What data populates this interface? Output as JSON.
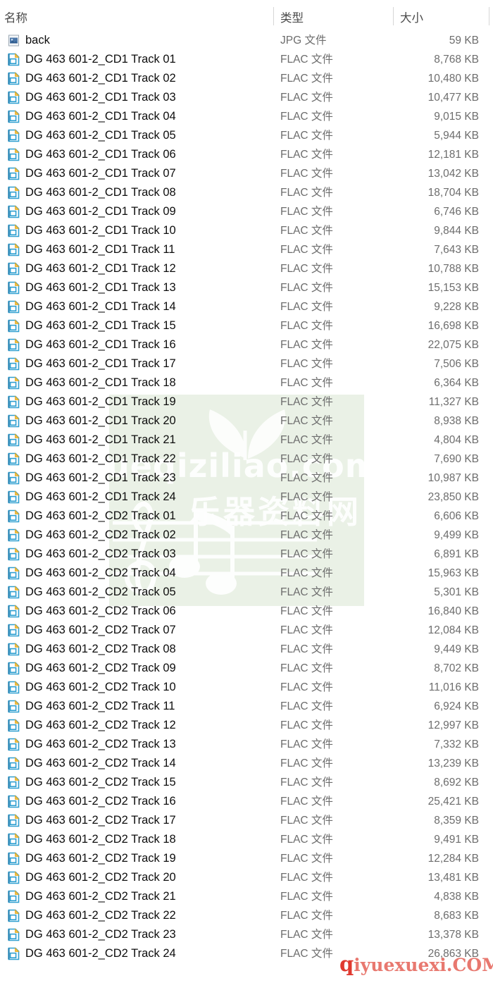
{
  "window": {
    "view": "details-list",
    "columns": [
      {
        "key": "name",
        "label": "名称",
        "align": "left"
      },
      {
        "key": "type",
        "label": "类型",
        "align": "left"
      },
      {
        "key": "size",
        "label": "大小",
        "align": "right"
      }
    ]
  },
  "watermarks": {
    "green_text": "yueqiziliao.com",
    "green_cn": "乐器资料网",
    "green_color": "#e3ecdd",
    "red_text_lead": "q",
    "red_text_rest": "iyuexuexi.COM",
    "red_color": "#e8786f"
  },
  "icons": {
    "image_file": "image-file-icon",
    "flac_file": "flac-file-icon"
  },
  "rows": [
    {
      "icon": "image-file-icon",
      "name": "back",
      "type": "JPG 文件",
      "size": "59 KB"
    },
    {
      "icon": "flac-file-icon",
      "name": "DG 463 601-2_CD1 Track 01",
      "type": "FLAC 文件",
      "size": "8,768 KB"
    },
    {
      "icon": "flac-file-icon",
      "name": "DG 463 601-2_CD1 Track 02",
      "type": "FLAC 文件",
      "size": "10,480 KB"
    },
    {
      "icon": "flac-file-icon",
      "name": "DG 463 601-2_CD1 Track 03",
      "type": "FLAC 文件",
      "size": "10,477 KB"
    },
    {
      "icon": "flac-file-icon",
      "name": "DG 463 601-2_CD1 Track 04",
      "type": "FLAC 文件",
      "size": "9,015 KB"
    },
    {
      "icon": "flac-file-icon",
      "name": "DG 463 601-2_CD1 Track 05",
      "type": "FLAC 文件",
      "size": "5,944 KB"
    },
    {
      "icon": "flac-file-icon",
      "name": "DG 463 601-2_CD1 Track 06",
      "type": "FLAC 文件",
      "size": "12,181 KB"
    },
    {
      "icon": "flac-file-icon",
      "name": "DG 463 601-2_CD1 Track 07",
      "type": "FLAC 文件",
      "size": "13,042 KB"
    },
    {
      "icon": "flac-file-icon",
      "name": "DG 463 601-2_CD1 Track 08",
      "type": "FLAC 文件",
      "size": "18,704 KB"
    },
    {
      "icon": "flac-file-icon",
      "name": "DG 463 601-2_CD1 Track 09",
      "type": "FLAC 文件",
      "size": "6,746 KB"
    },
    {
      "icon": "flac-file-icon",
      "name": "DG 463 601-2_CD1 Track 10",
      "type": "FLAC 文件",
      "size": "9,844 KB"
    },
    {
      "icon": "flac-file-icon",
      "name": "DG 463 601-2_CD1 Track 11",
      "type": "FLAC 文件",
      "size": "7,643 KB"
    },
    {
      "icon": "flac-file-icon",
      "name": "DG 463 601-2_CD1 Track 12",
      "type": "FLAC 文件",
      "size": "10,788 KB"
    },
    {
      "icon": "flac-file-icon",
      "name": "DG 463 601-2_CD1 Track 13",
      "type": "FLAC 文件",
      "size": "15,153 KB"
    },
    {
      "icon": "flac-file-icon",
      "name": "DG 463 601-2_CD1 Track 14",
      "type": "FLAC 文件",
      "size": "9,228 KB"
    },
    {
      "icon": "flac-file-icon",
      "name": "DG 463 601-2_CD1 Track 15",
      "type": "FLAC 文件",
      "size": "16,698 KB"
    },
    {
      "icon": "flac-file-icon",
      "name": "DG 463 601-2_CD1 Track 16",
      "type": "FLAC 文件",
      "size": "22,075 KB"
    },
    {
      "icon": "flac-file-icon",
      "name": "DG 463 601-2_CD1 Track 17",
      "type": "FLAC 文件",
      "size": "7,506 KB"
    },
    {
      "icon": "flac-file-icon",
      "name": "DG 463 601-2_CD1 Track 18",
      "type": "FLAC 文件",
      "size": "6,364 KB"
    },
    {
      "icon": "flac-file-icon",
      "name": "DG 463 601-2_CD1 Track 19",
      "type": "FLAC 文件",
      "size": "11,327 KB"
    },
    {
      "icon": "flac-file-icon",
      "name": "DG 463 601-2_CD1 Track 20",
      "type": "FLAC 文件",
      "size": "8,938 KB"
    },
    {
      "icon": "flac-file-icon",
      "name": "DG 463 601-2_CD1 Track 21",
      "type": "FLAC 文件",
      "size": "4,804 KB"
    },
    {
      "icon": "flac-file-icon",
      "name": "DG 463 601-2_CD1 Track 22",
      "type": "FLAC 文件",
      "size": "7,690 KB"
    },
    {
      "icon": "flac-file-icon",
      "name": "DG 463 601-2_CD1 Track 23",
      "type": "FLAC 文件",
      "size": "10,987 KB"
    },
    {
      "icon": "flac-file-icon",
      "name": "DG 463 601-2_CD1 Track 24",
      "type": "FLAC 文件",
      "size": "23,850 KB"
    },
    {
      "icon": "flac-file-icon",
      "name": "DG 463 601-2_CD2 Track 01",
      "type": "FLAC 文件",
      "size": "6,606 KB"
    },
    {
      "icon": "flac-file-icon",
      "name": "DG 463 601-2_CD2 Track 02",
      "type": "FLAC 文件",
      "size": "9,499 KB"
    },
    {
      "icon": "flac-file-icon",
      "name": "DG 463 601-2_CD2 Track 03",
      "type": "FLAC 文件",
      "size": "6,891 KB"
    },
    {
      "icon": "flac-file-icon",
      "name": "DG 463 601-2_CD2 Track 04",
      "type": "FLAC 文件",
      "size": "15,963 KB"
    },
    {
      "icon": "flac-file-icon",
      "name": "DG 463 601-2_CD2 Track 05",
      "type": "FLAC 文件",
      "size": "5,301 KB"
    },
    {
      "icon": "flac-file-icon",
      "name": "DG 463 601-2_CD2 Track 06",
      "type": "FLAC 文件",
      "size": "16,840 KB"
    },
    {
      "icon": "flac-file-icon",
      "name": "DG 463 601-2_CD2 Track 07",
      "type": "FLAC 文件",
      "size": "12,084 KB"
    },
    {
      "icon": "flac-file-icon",
      "name": "DG 463 601-2_CD2 Track 08",
      "type": "FLAC 文件",
      "size": "9,449 KB"
    },
    {
      "icon": "flac-file-icon",
      "name": "DG 463 601-2_CD2 Track 09",
      "type": "FLAC 文件",
      "size": "8,702 KB"
    },
    {
      "icon": "flac-file-icon",
      "name": "DG 463 601-2_CD2 Track 10",
      "type": "FLAC 文件",
      "size": "11,016 KB"
    },
    {
      "icon": "flac-file-icon",
      "name": "DG 463 601-2_CD2 Track 11",
      "type": "FLAC 文件",
      "size": "6,924 KB"
    },
    {
      "icon": "flac-file-icon",
      "name": "DG 463 601-2_CD2 Track 12",
      "type": "FLAC 文件",
      "size": "12,997 KB"
    },
    {
      "icon": "flac-file-icon",
      "name": "DG 463 601-2_CD2 Track 13",
      "type": "FLAC 文件",
      "size": "7,332 KB"
    },
    {
      "icon": "flac-file-icon",
      "name": "DG 463 601-2_CD2 Track 14",
      "type": "FLAC 文件",
      "size": "13,239 KB"
    },
    {
      "icon": "flac-file-icon",
      "name": "DG 463 601-2_CD2 Track 15",
      "type": "FLAC 文件",
      "size": "8,692 KB"
    },
    {
      "icon": "flac-file-icon",
      "name": "DG 463 601-2_CD2 Track 16",
      "type": "FLAC 文件",
      "size": "25,421 KB"
    },
    {
      "icon": "flac-file-icon",
      "name": "DG 463 601-2_CD2 Track 17",
      "type": "FLAC 文件",
      "size": "8,359 KB"
    },
    {
      "icon": "flac-file-icon",
      "name": "DG 463 601-2_CD2 Track 18",
      "type": "FLAC 文件",
      "size": "9,491 KB"
    },
    {
      "icon": "flac-file-icon",
      "name": "DG 463 601-2_CD2 Track 19",
      "type": "FLAC 文件",
      "size": "12,284 KB"
    },
    {
      "icon": "flac-file-icon",
      "name": "DG 463 601-2_CD2 Track 20",
      "type": "FLAC 文件",
      "size": "13,481 KB"
    },
    {
      "icon": "flac-file-icon",
      "name": "DG 463 601-2_CD2 Track 21",
      "type": "FLAC 文件",
      "size": "4,838 KB"
    },
    {
      "icon": "flac-file-icon",
      "name": "DG 463 601-2_CD2 Track 22",
      "type": "FLAC 文件",
      "size": "8,683 KB"
    },
    {
      "icon": "flac-file-icon",
      "name": "DG 463 601-2_CD2 Track 23",
      "type": "FLAC 文件",
      "size": "13,378 KB"
    },
    {
      "icon": "flac-file-icon",
      "name": "DG 463 601-2_CD2 Track 24",
      "type": "FLAC 文件",
      "size": "26,863 KB"
    }
  ]
}
